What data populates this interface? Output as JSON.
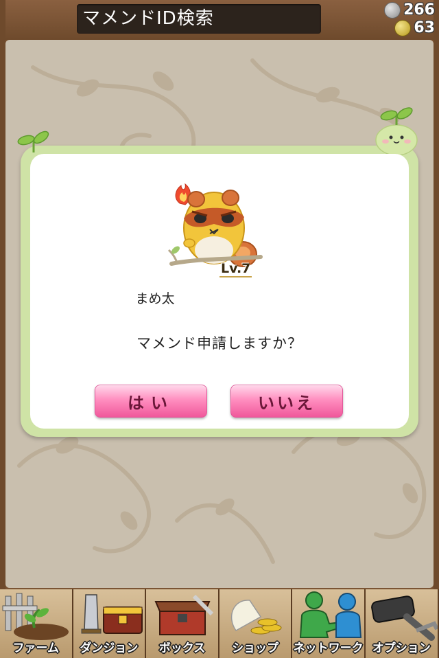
{
  "header": {
    "title": "マメンドID検索",
    "silver_count": "266",
    "gold_count": "63"
  },
  "dialog": {
    "character_name": "まめ太",
    "level": "Lv.7",
    "question": "マメンド申請しますか？",
    "yes_label": "はい",
    "no_label": "いいえ"
  },
  "menu": {
    "items": [
      {
        "label": "ファーム",
        "icon": "farm-icon"
      },
      {
        "label": "ダンジョン",
        "icon": "dungeon-icon"
      },
      {
        "label": "ボックス",
        "icon": "box-icon"
      },
      {
        "label": "ショップ",
        "icon": "shop-icon"
      },
      {
        "label": "ネットワーク",
        "icon": "network-icon"
      },
      {
        "label": "オプション",
        "icon": "options-icon"
      }
    ]
  },
  "colors": {
    "frame": "#7a5434",
    "panel": "#c9bfae",
    "dialog_border": "#cfe3a6",
    "button_pink": "#f0589b"
  }
}
